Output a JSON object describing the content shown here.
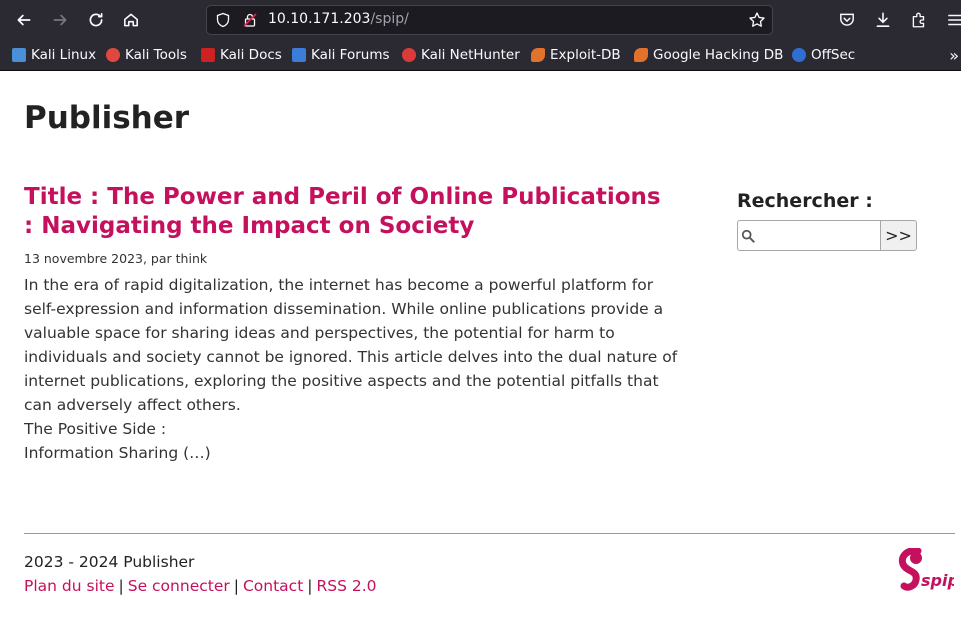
{
  "browser": {
    "url_host": "10.10.171.203",
    "url_path": "/spip/",
    "bookmarks": [
      {
        "label": "Kali Linux",
        "icon": "kali-dragon-icon",
        "color": "#4a90d9"
      },
      {
        "label": "Kali Tools",
        "icon": "kali-tools-icon",
        "color": "#e0483e"
      },
      {
        "label": "Kali Docs",
        "icon": "kali-docs-icon",
        "color": "#cc2222"
      },
      {
        "label": "Kali Forums",
        "icon": "kali-forums-icon",
        "color": "#3b7dd8"
      },
      {
        "label": "Kali NetHunter",
        "icon": "kali-nethunter-icon",
        "color": "#d93b3b"
      },
      {
        "label": "Exploit-DB",
        "icon": "exploit-db-icon",
        "color": "#e0722c"
      },
      {
        "label": "Google Hacking DB",
        "icon": "ghdb-icon",
        "color": "#e0722c"
      },
      {
        "label": "OffSec",
        "icon": "offsec-icon",
        "color": "#2f6fd1"
      }
    ]
  },
  "site": {
    "title": "Publisher"
  },
  "article": {
    "title": "Title : The Power and Peril of Online Publications : Navigating the Impact on Society",
    "meta": "13 novembre 2023, par think",
    "intro": "In the era of rapid digitalization, the internet has become a powerful platform for self-expression and information dissemination. While online publications provide a valuable space for sharing ideas and perspectives, the potential for harm to individuals and society cannot be ignored. This article delves into the dual nature of internet publications, exploring the positive aspects and the potential pitfalls that can adversely affect others.",
    "subhead": "The Positive Side :",
    "excerpt_end": "Information Sharing (…)"
  },
  "search": {
    "label": "Rechercher :",
    "value": "",
    "button": ">>"
  },
  "footer": {
    "copyright": "2023 - 2024 Publisher",
    "links": [
      "Plan du site",
      "Se connecter",
      "Contact",
      "RSS 2.0"
    ],
    "separator": "|",
    "logo_text": "spip"
  },
  "colors": {
    "accent": "#c5115d",
    "chrome": "#2b2a33"
  }
}
